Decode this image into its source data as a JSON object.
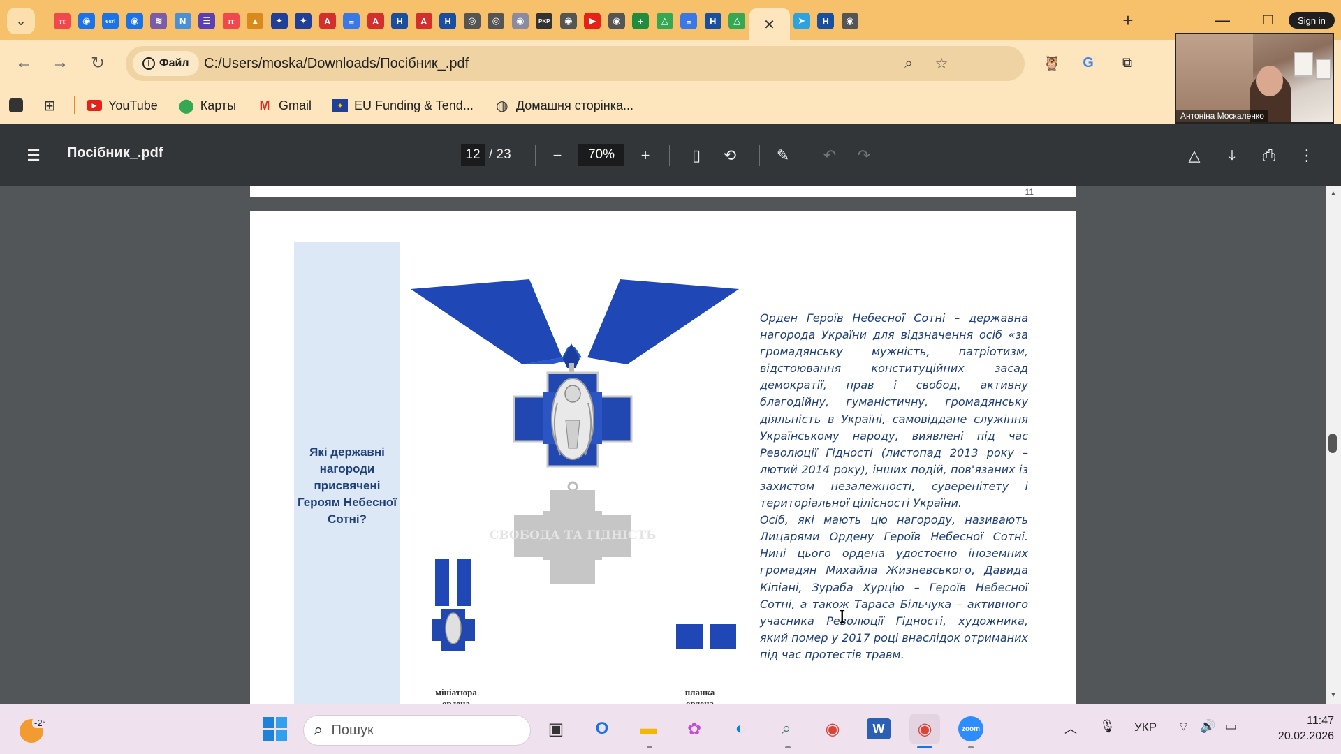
{
  "browser": {
    "tab_favicons": [
      {
        "icon": "pi-icon",
        "color": "#f0484d",
        "glyph": "π"
      },
      {
        "icon": "globe-icon",
        "color": "#1a73e8",
        "glyph": "◉"
      },
      {
        "icon": "esri-icon",
        "color": "#1a73e8",
        "glyph": "esri"
      },
      {
        "icon": "globe-icon",
        "color": "#1a73e8",
        "glyph": "◉"
      },
      {
        "icon": "flag-icon",
        "color": "#7a5ca8",
        "glyph": "≋"
      },
      {
        "icon": "un-icon",
        "color": "#4a90d9",
        "glyph": "N"
      },
      {
        "icon": "list-icon",
        "color": "#5b3fb5",
        "glyph": "☰"
      },
      {
        "icon": "pi-icon",
        "color": "#f0484d",
        "glyph": "π"
      },
      {
        "icon": "graduation-icon",
        "color": "#d98a1a",
        "glyph": "▲"
      },
      {
        "icon": "eu-icon",
        "color": "#1f3f99",
        "glyph": "✦"
      },
      {
        "icon": "eu-icon",
        "color": "#1f3f99",
        "glyph": "✦"
      },
      {
        "icon": "pdf-icon",
        "color": "#d32f2f",
        "glyph": "A"
      },
      {
        "icon": "docs-icon",
        "color": "#3b78e7",
        "glyph": "≡"
      },
      {
        "icon": "pdf-icon",
        "color": "#d32f2f",
        "glyph": "A"
      },
      {
        "icon": "shield-icon",
        "color": "#1a4fa0",
        "glyph": "H"
      },
      {
        "icon": "pdf-icon",
        "color": "#d32f2f",
        "glyph": "A"
      },
      {
        "icon": "shield-icon",
        "color": "#1a4fa0",
        "glyph": "H"
      },
      {
        "icon": "chrome-icon",
        "color": "#555555",
        "glyph": "◎"
      },
      {
        "icon": "chrome-icon",
        "color": "#555555",
        "glyph": "◎"
      },
      {
        "icon": "globe-icon",
        "color": "#8a8aa0",
        "glyph": "◉"
      },
      {
        "icon": "pkp-icon",
        "color": "#333333",
        "glyph": "PKP"
      },
      {
        "icon": "globe-icon",
        "color": "#555555",
        "glyph": "◉"
      },
      {
        "icon": "youtube-icon",
        "color": "#e62117",
        "glyph": "▶"
      },
      {
        "icon": "globe-icon",
        "color": "#555555",
        "glyph": "◉"
      },
      {
        "icon": "plus-green-icon",
        "color": "#1e8e3e",
        "glyph": "+"
      },
      {
        "icon": "drive-icon",
        "color": "#34a853",
        "glyph": "△"
      },
      {
        "icon": "docs-icon",
        "color": "#3b78e7",
        "glyph": "≡"
      },
      {
        "icon": "shield-icon",
        "color": "#1a4fa0",
        "glyph": "H"
      },
      {
        "icon": "drive-icon",
        "color": "#34a853",
        "glyph": "△"
      }
    ],
    "tab_favicons_after": [
      {
        "icon": "telegram-icon",
        "color": "#2aa3e0",
        "glyph": "➤"
      },
      {
        "icon": "shield-icon",
        "color": "#1a4fa0",
        "glyph": "H"
      },
      {
        "icon": "globe-icon",
        "color": "#555555",
        "glyph": "◉"
      }
    ],
    "active_tab_close": "✕",
    "sign_in": "Sign in",
    "address": {
      "chip_label": "Файл",
      "url": "C:/Users/moska/Downloads/Посібник_.pdf"
    },
    "bookmarks": [
      {
        "label": "",
        "icon": "square-icon"
      },
      {
        "label": "",
        "icon": "apps-grid-icon"
      },
      {
        "label": "YouTube",
        "icon": "youtube-icon"
      },
      {
        "label": "Карты",
        "icon": "maps-pin-icon"
      },
      {
        "label": "Gmail",
        "icon": "gmail-icon"
      },
      {
        "label": "EU Funding & Tend...",
        "icon": "eu-flag-icon"
      },
      {
        "label": "Домашня сторінка...",
        "icon": "globe-icon"
      }
    ]
  },
  "video": {
    "participant_name": "Антоніна Москаленко"
  },
  "pdf_viewer": {
    "file_title": "Посібник_.pdf",
    "current_page": "12",
    "total_pages": "/ 23",
    "zoom": "70%",
    "prev_page_number": "11"
  },
  "document": {
    "question": "Які державні нагороди присвячені Героям Небесної Сотні?",
    "medal_back_inscription": "СВОБОДА ТА ГІДНІСТЬ",
    "miniature_caption": "мініатюра ордена",
    "ribbon_caption": "планка ордена",
    "paragraph_1": "Орден Героїв Небесної Сотні – державна нагорода України для відзначення осіб «за громадянську мужність, патріотизм, відстоювання конституційних засад демократії, прав і свобод, активну благодійну, гуманістичну, громадянську діяльність в Україні, самовіддане служіння Українському народу, виявлені під час Революції Гідності (листопад 2013 року – лютий 2014 року), інших подій, пов'язаних із захистом незалежності, суверенітету і територіальної цілісності України.",
    "paragraph_2": "Осіб, які мають цю нагороду, називають Лицарями Ордену Героїв Небесної Сотні. Нині цього ордена удостоєно іноземних громадян Михайла Жизневського, Давида Кіпіані, Зураба Хурцію – Героїв Небесної Сотні, а також Тараса Більчука – активного учасника Революції Гідності, художника, який помер у 2017 році внаслідок отриманих під час протестів травм."
  },
  "taskbar": {
    "weather_temp": "-2°",
    "search_placeholder": "Пошук",
    "language": "УКР",
    "time": "11:47",
    "date": "20.02.2026"
  },
  "colors": {
    "tabstrip": "#f7c06a",
    "toolbar": "#fde6bd",
    "pdf_toolbar": "#323639",
    "viewer_bg": "#525659",
    "medal_blue": "#1f47b5",
    "doc_text": "#1f3f7a",
    "sidebar_box": "#dce8f5"
  }
}
